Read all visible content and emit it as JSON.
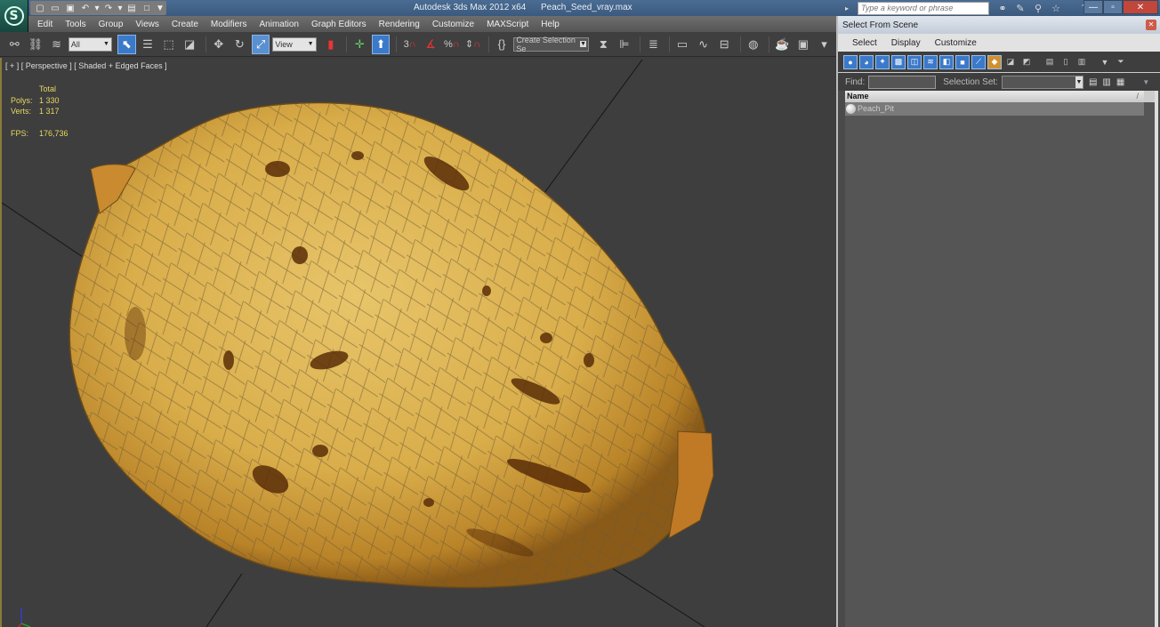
{
  "app": {
    "title": "Autodesk 3ds Max  2012 x64",
    "filename": "Peach_Seed_vray.max",
    "logo_icon": "3ds-max-logo-icon"
  },
  "quick_access": [
    {
      "icon": "new-file-icon",
      "glyph": "▢"
    },
    {
      "icon": "open-file-icon",
      "glyph": "▭"
    },
    {
      "icon": "save-icon",
      "glyph": "▣"
    },
    {
      "icon": "undo-icon",
      "glyph": "↶"
    },
    {
      "icon": "dropdown-icon",
      "glyph": "▾"
    },
    {
      "icon": "redo-icon",
      "glyph": "↷"
    },
    {
      "icon": "dropdown-icon",
      "glyph": "▾"
    },
    {
      "icon": "project-folder-icon",
      "glyph": "▤"
    },
    {
      "icon": "window-icon",
      "glyph": "□"
    },
    {
      "icon": "more-icon",
      "glyph": "▼"
    }
  ],
  "search": {
    "placeholder": "Type a keyword or phrase",
    "icons": [
      {
        "name": "binoculars-icon",
        "glyph": "👁"
      },
      {
        "name": "wrench-icon",
        "glyph": "🔧"
      },
      {
        "name": "subscription-icon",
        "glyph": "⚲"
      },
      {
        "name": "favorites-star-icon",
        "glyph": "☆"
      },
      {
        "name": "help-icon",
        "glyph": "?"
      }
    ]
  },
  "window_controls": {
    "minimize": "—",
    "maximize": "▫",
    "close": "✕"
  },
  "menu": [
    "Edit",
    "Tools",
    "Group",
    "Views",
    "Create",
    "Modifiers",
    "Animation",
    "Graph Editors",
    "Rendering",
    "Customize",
    "MAXScript",
    "Help"
  ],
  "toolbar": {
    "selection_filter": "All",
    "reference_coord": "View",
    "named_selection": "Create Selection Se",
    "snap_label": "3"
  },
  "viewport": {
    "label": "[ + ] [ Perspective ] [ Shaded + Edged Faces ]",
    "stats": {
      "header": "Total",
      "rows": [
        {
          "key": "Polys:",
          "value": "1 330"
        },
        {
          "key": "Verts:",
          "value": "1 317"
        }
      ],
      "fps_key": "FPS:",
      "fps_value": "176,736"
    }
  },
  "panel": {
    "title": "Select From Scene",
    "menu": [
      "Select",
      "Display",
      "Customize"
    ],
    "find_label": "Find:",
    "find_value": "",
    "selection_set_label": "Selection Set:",
    "selection_set_value": "",
    "column_header": "Name",
    "sort_indicator": "/",
    "items": [
      {
        "name": "Peach_Pit",
        "icon": "geometry-sphere-icon"
      }
    ]
  }
}
